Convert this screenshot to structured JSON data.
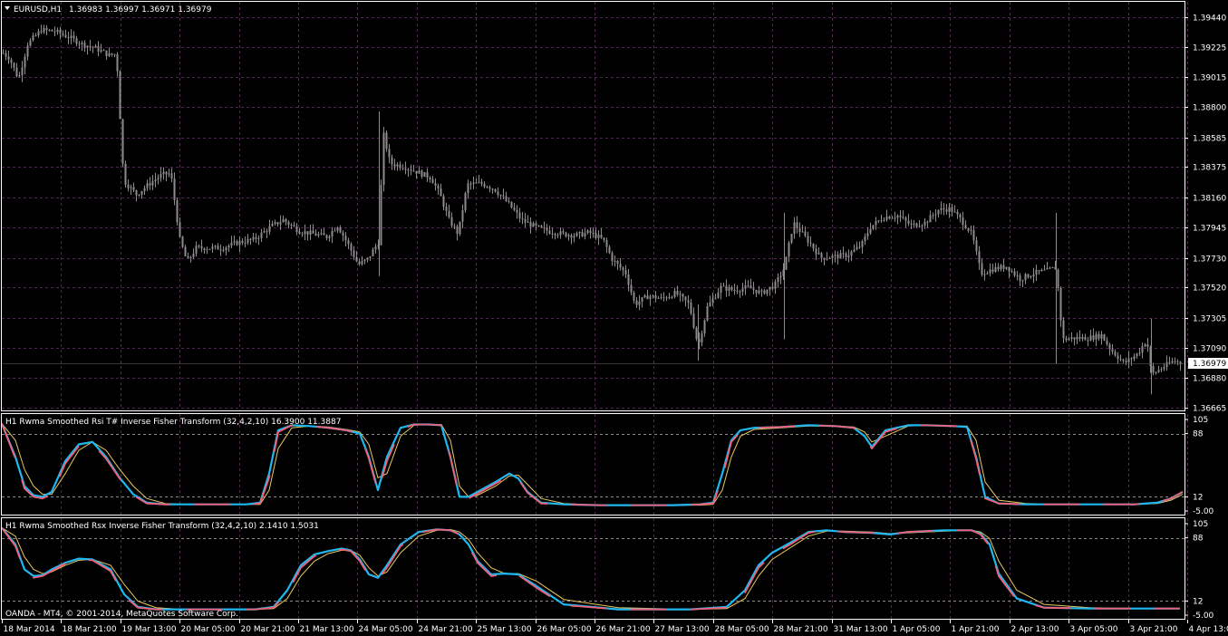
{
  "main_panel": {
    "symbol_label": "EURUSD,H1",
    "ohlc": "1.36983 1.36997 1.36971 1.36979",
    "price_ticks": [
      "1.39440",
      "1.39225",
      "1.39015",
      "1.38800",
      "1.38585",
      "1.38375",
      "1.38160",
      "1.37945",
      "1.37730",
      "1.37520",
      "1.37305",
      "1.37090",
      "1.36880",
      "1.36665"
    ],
    "current_price": "1.36979",
    "watermark": "OANDA - MT4, © 2001-2014, MetaQuotes Software Corp."
  },
  "indicator_1": {
    "title": "H1 Rwma Smoothed Rsi T# Inverse Fisher Transform (32,4,2,10) 16.3900 11.3887",
    "levels": [
      "105",
      "88",
      "12",
      "-5.00"
    ]
  },
  "indicator_2": {
    "title": "H1 Rwma Smoothed Rsx Inverse Fisher Transform (32,4,2,10) 2.1410 1.5031",
    "levels": [
      "105",
      "88",
      "12",
      "-5.00"
    ]
  },
  "time_axis": [
    "18 Mar 2014",
    "18 Mar 21:00",
    "19 Mar 13:00",
    "20 Mar 05:00",
    "20 Mar 21:00",
    "21 Mar 13:00",
    "24 Mar 05:00",
    "24 Mar 21:00",
    "25 Mar 13:00",
    "26 Mar 05:00",
    "26 Mar 21:00",
    "27 Mar 13:00",
    "28 Mar 05:00",
    "28 Mar 21:00",
    "31 Mar 13:00",
    "1 Apr 05:00",
    "1 Apr 21:00",
    "2 Apr 13:00",
    "3 Apr 05:00",
    "3 Apr 21:00",
    "4 Apr 13:00"
  ],
  "colors": {
    "background": "#000000",
    "grid": "#4a2a4a",
    "candle": "#8c8c8c",
    "axis_text": "#ffffff",
    "line_blue": "#1fb8f0",
    "line_pink": "#f0607a",
    "line_yellow": "#e8c860",
    "level_line": "#8a8a8a"
  },
  "chart_data": {
    "type": "line",
    "title": "EURUSD,H1",
    "ylim": [
      1.36665,
      1.3944
    ],
    "price_path": [
      [
        0,
        1.392
      ],
      [
        10,
        1.3915
      ],
      [
        20,
        1.39
      ],
      [
        30,
        1.3925
      ],
      [
        45,
        1.3935
      ],
      [
        60,
        1.3934
      ],
      [
        75,
        1.393
      ],
      [
        90,
        1.3925
      ],
      [
        105,
        1.3922
      ],
      [
        120,
        1.3917
      ],
      [
        128,
        1.3918
      ],
      [
        136,
        1.3828
      ],
      [
        150,
        1.3818
      ],
      [
        165,
        1.3826
      ],
      [
        178,
        1.3832
      ],
      [
        188,
        1.3833
      ],
      [
        198,
        1.3786
      ],
      [
        206,
        1.377
      ],
      [
        216,
        1.378
      ],
      [
        228,
        1.378
      ],
      [
        245,
        1.378
      ],
      [
        262,
        1.3784
      ],
      [
        280,
        1.3786
      ],
      [
        298,
        1.3795
      ],
      [
        312,
        1.38
      ],
      [
        330,
        1.3792
      ],
      [
        345,
        1.379
      ],
      [
        360,
        1.3788
      ],
      [
        372,
        1.3796
      ],
      [
        385,
        1.3781
      ],
      [
        395,
        1.3768
      ],
      [
        405,
        1.3772
      ],
      [
        418,
        1.3785
      ],
      [
        422,
        1.3863
      ],
      [
        430,
        1.384
      ],
      [
        445,
        1.3838
      ],
      [
        460,
        1.3834
      ],
      [
        475,
        1.383
      ],
      [
        485,
        1.3818
      ],
      [
        495,
        1.38
      ],
      [
        505,
        1.379
      ],
      [
        515,
        1.3825
      ],
      [
        530,
        1.3826
      ],
      [
        545,
        1.3822
      ],
      [
        560,
        1.3812
      ],
      [
        575,
        1.38
      ],
      [
        590,
        1.3795
      ],
      [
        605,
        1.3792
      ],
      [
        620,
        1.379
      ],
      [
        635,
        1.3789
      ],
      [
        650,
        1.3791
      ],
      [
        665,
        1.3786
      ],
      [
        675,
        1.3772
      ],
      [
        690,
        1.3762
      ],
      [
        700,
        1.374
      ],
      [
        715,
        1.3746
      ],
      [
        730,
        1.3744
      ],
      [
        745,
        1.3748
      ],
      [
        760,
        1.374
      ],
      [
        770,
        1.371
      ],
      [
        780,
        1.3738
      ],
      [
        795,
        1.3752
      ],
      [
        810,
        1.375
      ],
      [
        825,
        1.3752
      ],
      [
        840,
        1.3748
      ],
      [
        855,
        1.3754
      ],
      [
        865,
        1.3766
      ],
      [
        875,
        1.3798
      ],
      [
        885,
        1.379
      ],
      [
        895,
        1.3782
      ],
      [
        905,
        1.3773
      ],
      [
        920,
        1.3774
      ],
      [
        935,
        1.3775
      ],
      [
        950,
        1.3782
      ],
      [
        960,
        1.3795
      ],
      [
        975,
        1.3802
      ],
      [
        990,
        1.3803
      ],
      [
        1005,
        1.3796
      ],
      [
        1020,
        1.3798
      ],
      [
        1035,
        1.3807
      ],
      [
        1048,
        1.3808
      ],
      [
        1060,
        1.38
      ],
      [
        1072,
        1.379
      ],
      [
        1082,
        1.3762
      ],
      [
        1095,
        1.3765
      ],
      [
        1110,
        1.3767
      ],
      [
        1125,
        1.3758
      ],
      [
        1140,
        1.3762
      ],
      [
        1155,
        1.3764
      ],
      [
        1165,
        1.3766
      ],
      [
        1172,
        1.3715
      ],
      [
        1185,
        1.3716
      ],
      [
        1200,
        1.3716
      ],
      [
        1215,
        1.3718
      ],
      [
        1225,
        1.3708
      ],
      [
        1240,
        1.3698
      ],
      [
        1255,
        1.3705
      ],
      [
        1265,
        1.3715
      ],
      [
        1270,
        1.369
      ],
      [
        1282,
        1.3695
      ],
      [
        1295,
        1.37
      ],
      [
        1303,
        1.36979
      ]
    ],
    "indicator_1_series": {
      "x": [
        0,
        15,
        25,
        35,
        45,
        55,
        70,
        85,
        100,
        115,
        130,
        145,
        160,
        180,
        210,
        240,
        270,
        285,
        295,
        305,
        320,
        340,
        360,
        380,
        395,
        405,
        415,
        425,
        440,
        455,
        470,
        485,
        495,
        505,
        515,
        525,
        545,
        560,
        570,
        580,
        595,
        620,
        660,
        700,
        740,
        770,
        785,
        795,
        805,
        815,
        830,
        860,
        890,
        920,
        940,
        952,
        960,
        975,
        1000,
        1020,
        1050,
        1065,
        1075,
        1085,
        1100,
        1130,
        1160,
        1190,
        1220,
        1250,
        1275,
        1290,
        1303
      ],
      "blue": [
        100,
        60,
        25,
        14,
        12,
        18,
        55,
        75,
        78,
        60,
        35,
        15,
        5,
        3,
        3,
        3,
        3,
        5,
        40,
        92,
        98,
        97,
        95,
        92,
        88,
        60,
        20,
        60,
        95,
        99,
        99,
        98,
        60,
        12,
        12,
        18,
        30,
        40,
        34,
        18,
        5,
        3,
        2,
        2,
        2,
        3,
        5,
        40,
        80,
        92,
        95,
        96,
        98,
        97,
        95,
        85,
        72,
        92,
        98,
        98,
        97,
        96,
        60,
        12,
        4,
        3,
        3,
        3,
        3,
        3,
        5,
        10,
        18
      ],
      "pink": [
        100,
        58,
        22,
        12,
        10,
        15,
        52,
        73,
        76,
        58,
        34,
        14,
        4,
        3,
        3,
        3,
        3,
        4,
        35,
        90,
        98,
        97,
        95,
        92,
        88,
        58,
        18,
        55,
        93,
        99,
        99,
        98,
        60,
        10,
        10,
        16,
        28,
        38,
        33,
        17,
        4,
        3,
        2,
        2,
        2,
        3,
        4,
        35,
        78,
        90,
        95,
        96,
        98,
        97,
        95,
        83,
        70,
        90,
        98,
        98,
        97,
        96,
        58,
        10,
        4,
        3,
        3,
        3,
        3,
        3,
        5,
        10,
        18
      ],
      "yellow": [
        100,
        80,
        45,
        25,
        15,
        15,
        40,
        68,
        78,
        68,
        45,
        25,
        10,
        4,
        3,
        3,
        3,
        3,
        20,
        70,
        95,
        97,
        96,
        93,
        90,
        75,
        35,
        40,
        85,
        98,
        99,
        99,
        80,
        25,
        12,
        14,
        25,
        37,
        38,
        27,
        10,
        4,
        2,
        2,
        2,
        2,
        3,
        20,
        60,
        85,
        93,
        95,
        97,
        97,
        96,
        90,
        78,
        85,
        97,
        98,
        97,
        97,
        80,
        30,
        8,
        4,
        3,
        3,
        3,
        3,
        4,
        8,
        15
      ]
    },
    "indicator_2_series": {
      "x": [
        0,
        15,
        25,
        35,
        45,
        55,
        70,
        85,
        100,
        120,
        135,
        150,
        170,
        200,
        240,
        280,
        300,
        315,
        330,
        345,
        360,
        375,
        385,
        395,
        405,
        415,
        425,
        440,
        460,
        480,
        495,
        505,
        515,
        525,
        540,
        555,
        570,
        590,
        620,
        680,
        760,
        800,
        820,
        835,
        850,
        870,
        890,
        910,
        930,
        960,
        980,
        1000,
        1040,
        1070,
        1080,
        1090,
        1100,
        1120,
        1150,
        1200,
        1250,
        1300
      ],
      "blue": [
        100,
        80,
        50,
        42,
        43,
        50,
        58,
        63,
        62,
        50,
        20,
        5,
        2,
        2,
        2,
        2,
        5,
        25,
        55,
        68,
        72,
        75,
        73,
        62,
        44,
        40,
        55,
        80,
        95,
        98,
        97,
        92,
        80,
        60,
        44,
        45,
        44,
        30,
        8,
        2,
        2,
        5,
        25,
        55,
        70,
        82,
        95,
        97,
        95,
        94,
        92,
        95,
        97,
        97,
        93,
        80,
        45,
        15,
        4,
        3,
        3,
        3
      ],
      "pink": [
        100,
        78,
        48,
        40,
        42,
        48,
        57,
        62,
        61,
        48,
        18,
        4,
        2,
        2,
        2,
        2,
        4,
        22,
        52,
        66,
        71,
        74,
        72,
        60,
        42,
        38,
        52,
        78,
        94,
        98,
        97,
        92,
        78,
        58,
        42,
        44,
        43,
        28,
        7,
        2,
        2,
        4,
        22,
        52,
        68,
        80,
        94,
        97,
        95,
        94,
        92,
        95,
        97,
        97,
        92,
        78,
        42,
        13,
        4,
        3,
        3,
        3
      ],
      "yellow": [
        100,
        90,
        65,
        50,
        45,
        47,
        55,
        61,
        62,
        55,
        32,
        12,
        4,
        2,
        2,
        2,
        3,
        15,
        42,
        60,
        69,
        73,
        73,
        67,
        52,
        42,
        47,
        70,
        90,
        97,
        98,
        95,
        86,
        70,
        52,
        45,
        45,
        36,
        14,
        4,
        2,
        3,
        15,
        42,
        62,
        76,
        90,
        96,
        96,
        95,
        93,
        94,
        96,
        97,
        95,
        87,
        60,
        25,
        8,
        4,
        3,
        3
      ]
    }
  }
}
